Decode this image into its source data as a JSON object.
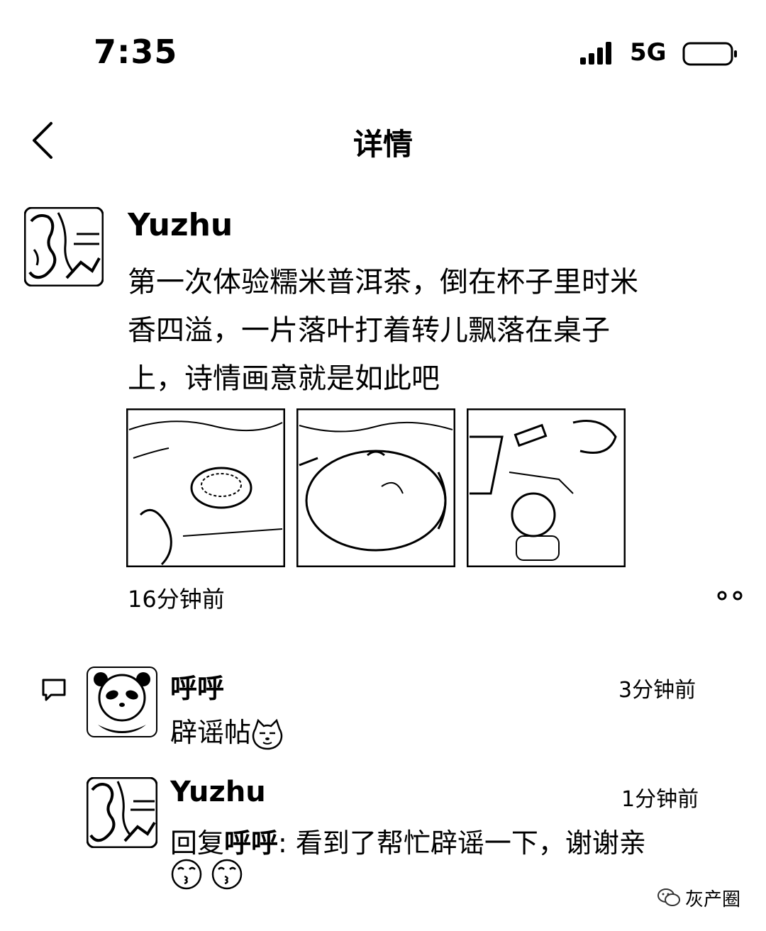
{
  "status_bar": {
    "time": "7:35",
    "network": "5G"
  },
  "nav": {
    "title": "详情"
  },
  "post": {
    "author": "Yuzhu",
    "text_lines": [
      "第一次体验糯米普洱茶，倒在杯子里时米",
      "香四溢，一片落叶打着转儿飘落在桌子",
      "上，诗情画意就是如此吧"
    ],
    "time": "16分钟前"
  },
  "comments": [
    {
      "author": "呼呼",
      "time": "3分钟前",
      "text": "辟谣帖"
    },
    {
      "author": "Yuzhu",
      "time": "1分钟前",
      "reply_prefix": "回复",
      "reply_to": "呼呼",
      "text": ": 看到了帮忙辟谣一下，谢谢亲"
    }
  ],
  "watermark": {
    "text": "灰产圈"
  }
}
